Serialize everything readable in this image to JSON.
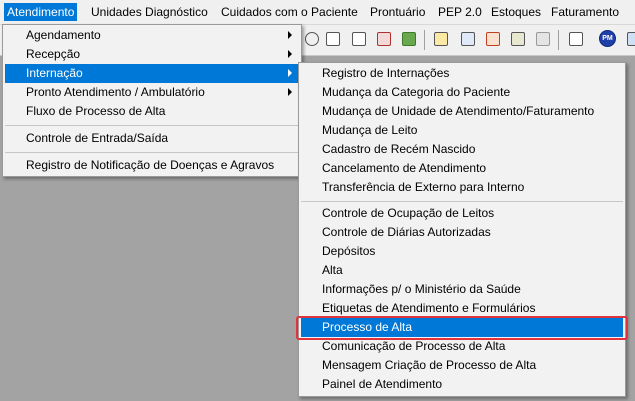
{
  "menubar": {
    "items": [
      {
        "label": "Atendimento"
      },
      {
        "label": "Unidades Diagnóstico"
      },
      {
        "label": "Cuidados com o Paciente"
      },
      {
        "label": "Prontuário"
      },
      {
        "label": "PEP 2.0"
      },
      {
        "label": "Estoques"
      },
      {
        "label": "Faturamento"
      }
    ]
  },
  "toolbar": {
    "pm_label": "PM",
    "icons": [
      "lock-icon",
      "print-icon",
      "print-list-icon",
      "print-report-icon",
      "chart-icon",
      "transfer-icon",
      "list-edit-icon",
      "notes-icon",
      "copy-icon",
      "monitor-icon",
      "pm-icon",
      "window-icon"
    ]
  },
  "atendimento_menu": {
    "items": [
      {
        "label": "Agendamento"
      },
      {
        "label": "Recepção"
      },
      {
        "label": "Internação"
      },
      {
        "label": "Pronto Atendimento / Ambulatório"
      },
      {
        "label": "Fluxo de Processo de Alta"
      },
      {
        "label": "Controle de Entrada/Saída"
      },
      {
        "label": "Registro de Notificação de Doenças e Agravos"
      }
    ]
  },
  "internacao_menu": {
    "items": [
      {
        "label": "Registro de Internações"
      },
      {
        "label": "Mudança da Categoria do Paciente"
      },
      {
        "label": "Mudança de Unidade de Atendimento/Faturamento"
      },
      {
        "label": "Mudança de Leito"
      },
      {
        "label": "Cadastro de Recém Nascido"
      },
      {
        "label": "Cancelamento de Atendimento"
      },
      {
        "label": "Transferência de Externo para Interno"
      },
      {
        "label": "Controle de Ocupação de Leitos"
      },
      {
        "label": "Controle de Diárias Autorizadas"
      },
      {
        "label": "Depósitos"
      },
      {
        "label": "Alta"
      },
      {
        "label": "Informações p/ o Ministério da Saúde"
      },
      {
        "label": "Etiquetas de Atendimento e Formulários"
      },
      {
        "label": "Processo de Alta"
      },
      {
        "label": "Comunicação de Processo de Alta"
      },
      {
        "label": "Mensagem Criação de Processo de Alta"
      },
      {
        "label": "Painel de Atendimento"
      }
    ]
  },
  "colors": {
    "highlight": "#0078d7",
    "callout": "#e0333c"
  }
}
